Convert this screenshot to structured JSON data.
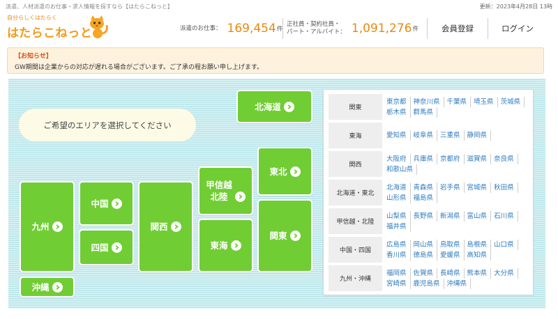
{
  "header": {
    "tagline": "派遣、人材派遣のお仕事・求人情報を探すなら【はたらこねっと】",
    "updated": "更新：2023年4月28日 13時",
    "logo_small": "自分らしくはたらく",
    "logo_main": "はたらこねっと",
    "stats": [
      {
        "label": "派遣のお仕事：",
        "value": "169,454",
        "unit": "件"
      },
      {
        "label_line1": "正社員・契約社員・",
        "label_line2": "パート・アルバイト：",
        "value": "1,091,276",
        "unit": "件"
      }
    ],
    "register_label": "会員登録",
    "login_label": "ログイン"
  },
  "notice": {
    "title": "【お知らせ】",
    "text": "GW期間は企業からの対応が遅れる場合がございます。ご了承の程お願い申し上げます。"
  },
  "map": {
    "prompt": "ご希望のエリアを選択してください",
    "regions": {
      "hokkaido": "北海道",
      "tohoku": "東北",
      "koshinetsu_line1": "甲信越",
      "koshinetsu_line2": "北陸",
      "kanto": "関東",
      "tokai": "東海",
      "kansai": "関西",
      "chugoku": "中国",
      "shikoku": "四国",
      "kyushu": "九州",
      "okinawa": "沖縄"
    },
    "region_color": "#70cd34"
  },
  "prefectures": [
    {
      "area": "関東",
      "prefs": [
        "東京都",
        "神奈川県",
        "千葉県",
        "埼玉県",
        "茨城県",
        "栃木県",
        "群馬県"
      ]
    },
    {
      "area": "東海",
      "prefs": [
        "愛知県",
        "岐阜県",
        "三重県",
        "静岡県"
      ]
    },
    {
      "area": "関西",
      "prefs": [
        "大阪府",
        "兵庫県",
        "京都府",
        "滋賀県",
        "奈良県",
        "和歌山県"
      ]
    },
    {
      "area": "北海道・東北",
      "prefs": [
        "北海道",
        "青森県",
        "岩手県",
        "宮城県",
        "秋田県",
        "山形県",
        "福島県"
      ]
    },
    {
      "area": "甲信越・北陸",
      "prefs": [
        "山梨県",
        "長野県",
        "新潟県",
        "富山県",
        "石川県",
        "福井県"
      ]
    },
    {
      "area": "中国・四国",
      "prefs": [
        "広島県",
        "岡山県",
        "鳥取県",
        "島根県",
        "山口県",
        "香川県",
        "徳島県",
        "愛媛県",
        "高知県"
      ]
    },
    {
      "area": "九州・沖縄",
      "prefs": [
        "福岡県",
        "佐賀県",
        "長崎県",
        "熊本県",
        "大分県",
        "宮崎県",
        "鹿児島県",
        "沖縄県"
      ]
    }
  ]
}
